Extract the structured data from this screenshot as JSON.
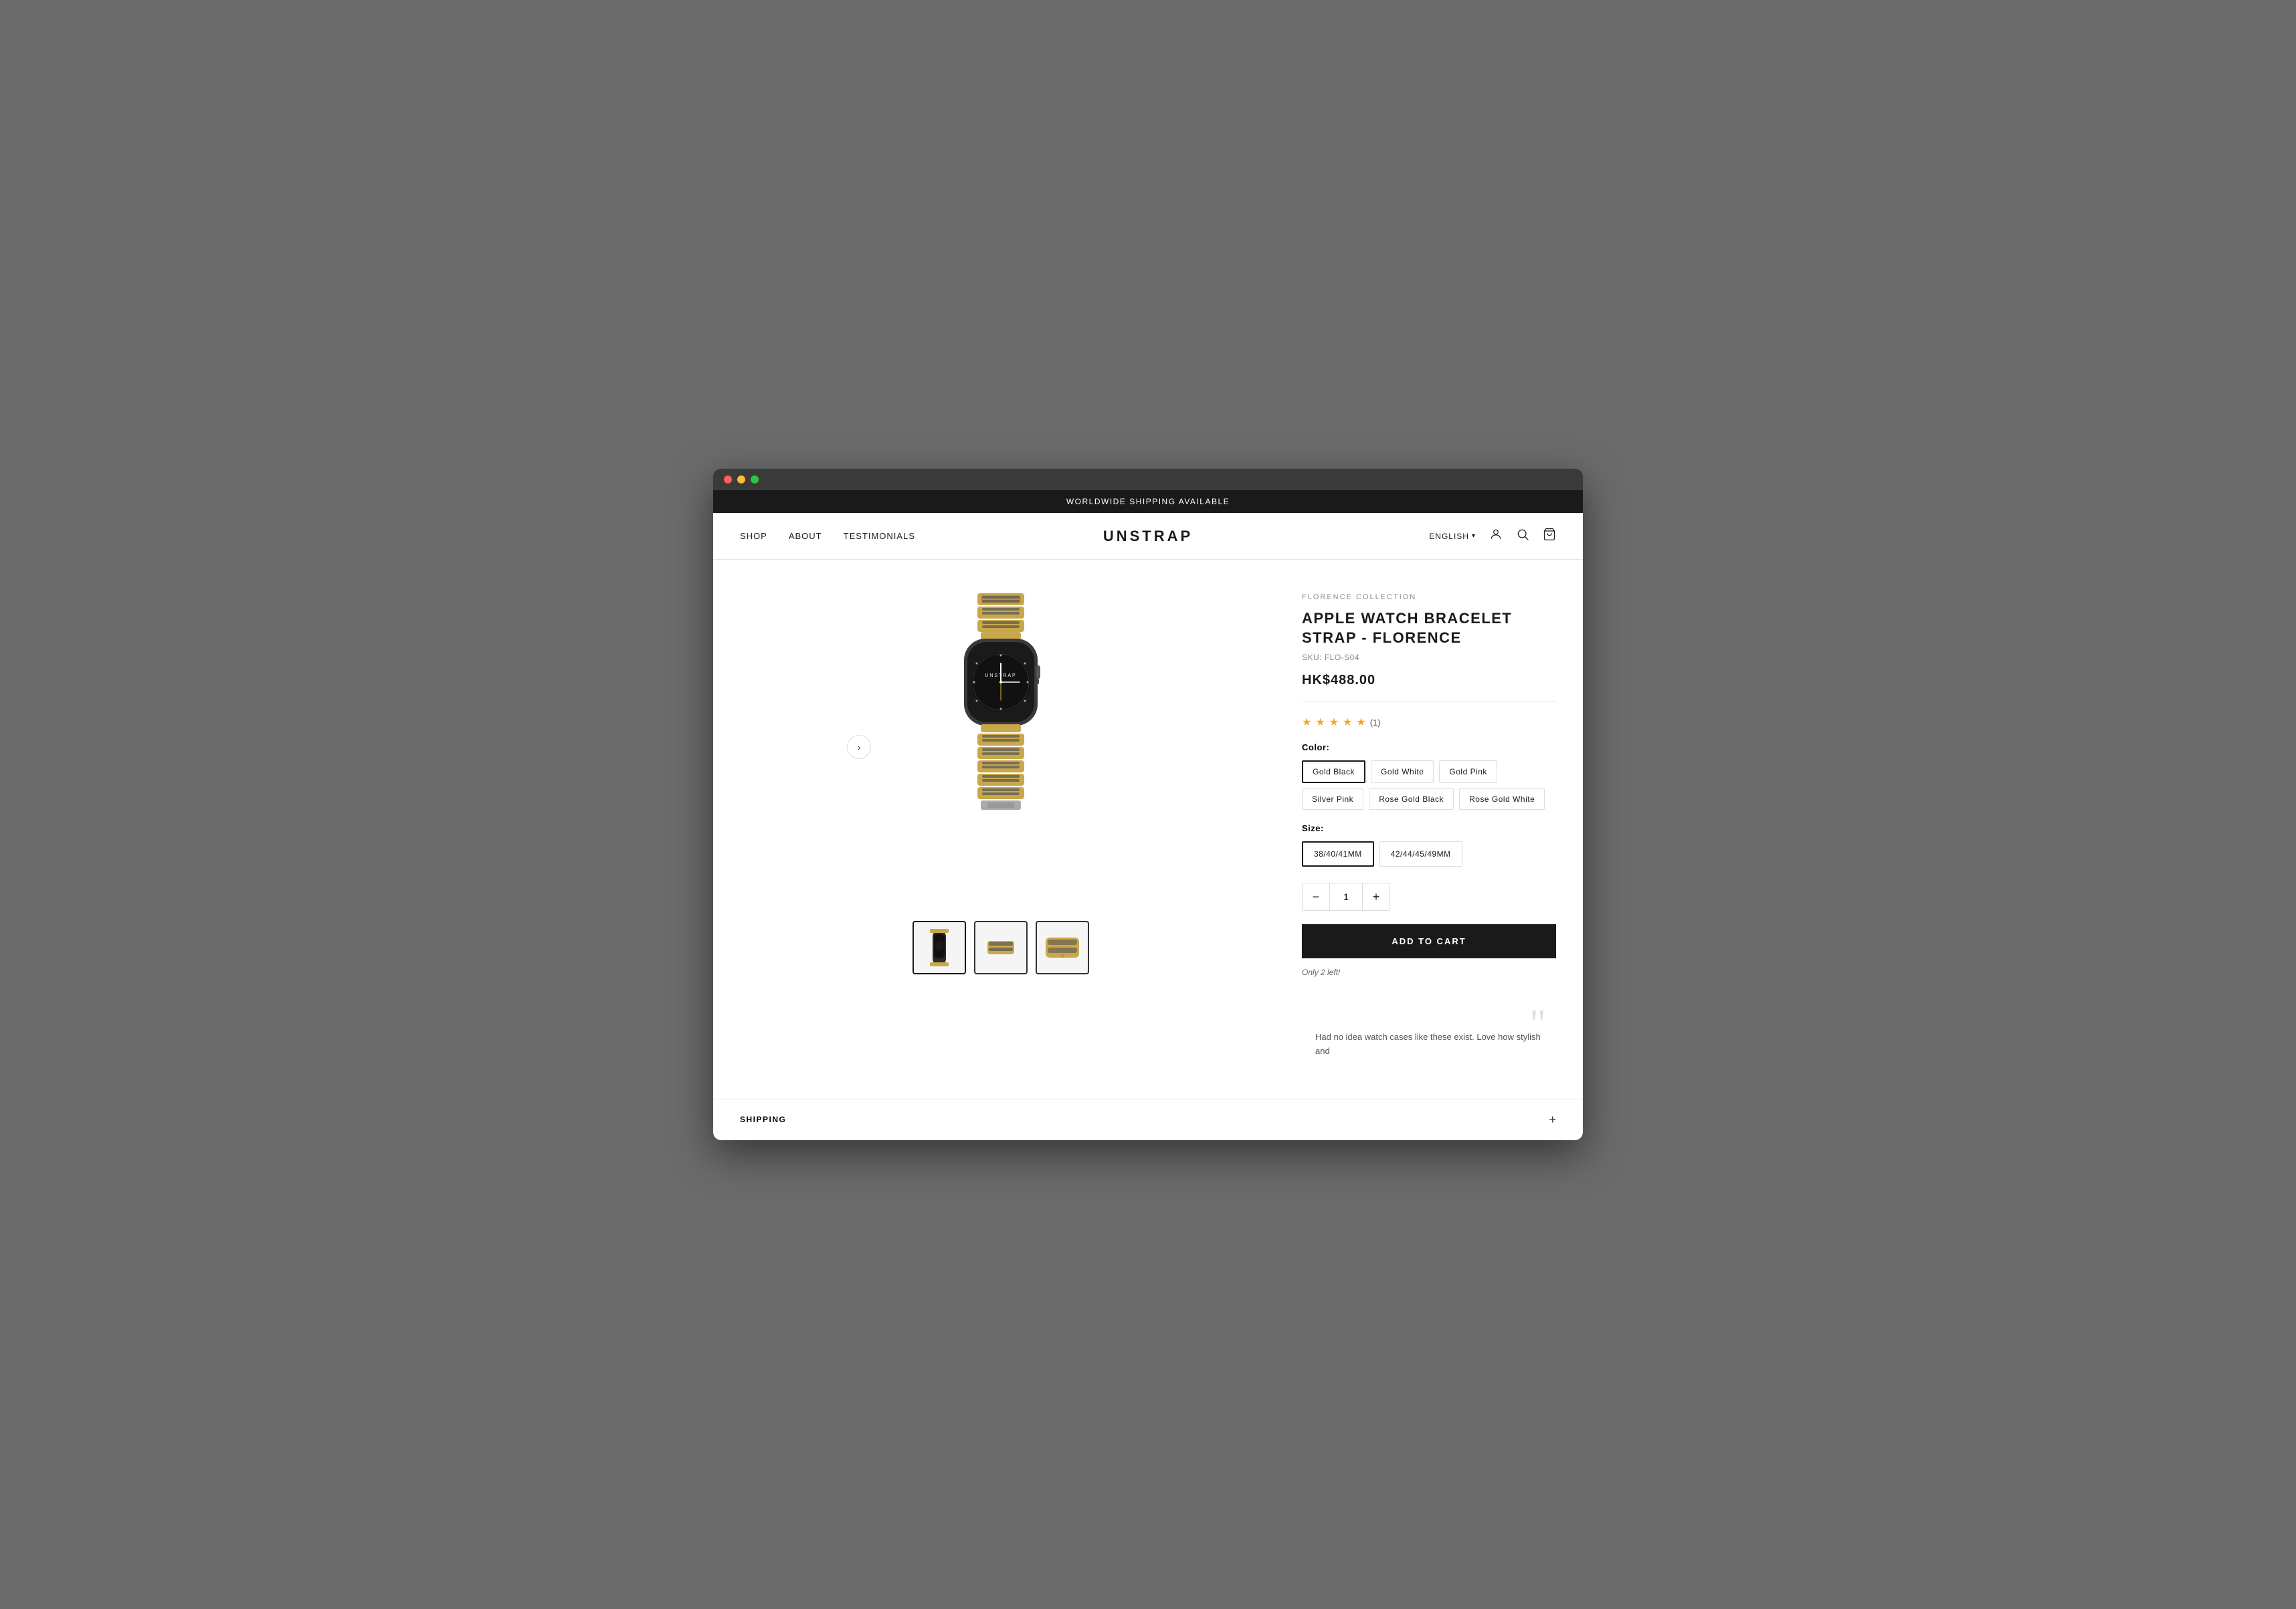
{
  "announcement": {
    "text": "WORLDWIDE SHIPPING AVAILABLE"
  },
  "header": {
    "nav": [
      {
        "label": "SHOP",
        "href": "#"
      },
      {
        "label": "ABOUT",
        "href": "#"
      },
      {
        "label": "TESTIMONIALS",
        "href": "#"
      }
    ],
    "logo": "UNSTRAP",
    "language": "ENGLISH",
    "icons": {
      "account": "👤",
      "search": "🔍",
      "cart": "🛍"
    }
  },
  "product": {
    "collection": "FLORENCE COLLECTION",
    "title": "APPLE WATCH BRACELET STRAP - FLORENCE",
    "sku": "SKU: FLO-S04",
    "price": "HK$488.00",
    "rating": 5,
    "review_count": "(1)",
    "color_label": "Color:",
    "colors": [
      {
        "label": "Gold Black",
        "active": true
      },
      {
        "label": "Gold White",
        "active": false
      },
      {
        "label": "Gold Pink",
        "active": false
      },
      {
        "label": "Silver Pink",
        "active": false
      },
      {
        "label": "Rose Gold Black",
        "active": false
      },
      {
        "label": "Rose Gold White",
        "active": false
      }
    ],
    "size_label": "Size:",
    "sizes": [
      {
        "label": "38/40/41MM",
        "active": true
      },
      {
        "label": "42/44/45/49MM",
        "active": false
      }
    ],
    "quantity": 1,
    "add_to_cart": "ADD TO CART",
    "stock_notice": "Only 2 left!",
    "testimonial_quote": "Had no idea watch cases like these exist. Love how stylish and"
  },
  "shipping_section": {
    "label": "SHIPPING"
  },
  "thumbnails": [
    {
      "alt": "Watch front view",
      "active": true
    },
    {
      "alt": "Watch side view",
      "active": false
    },
    {
      "alt": "Watch detail view",
      "active": false
    }
  ]
}
